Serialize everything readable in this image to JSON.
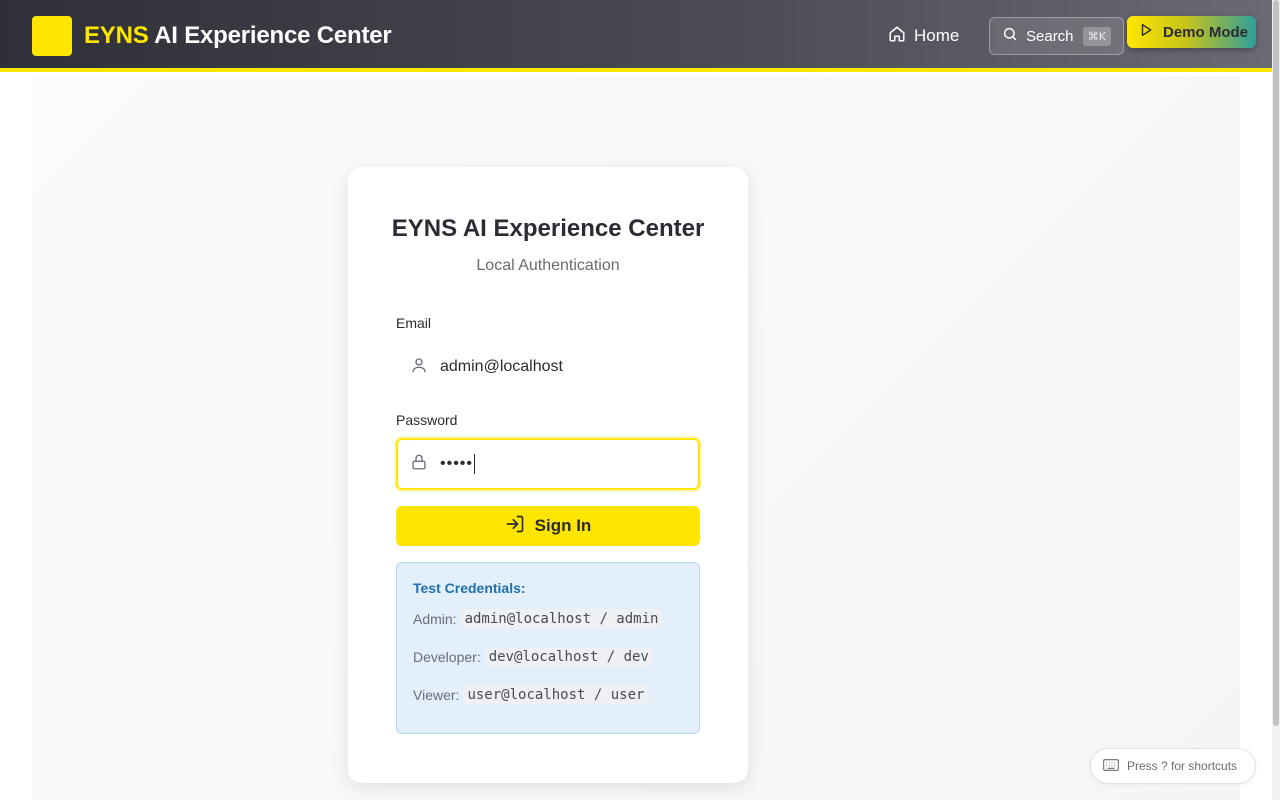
{
  "header": {
    "brand_accent": "EYNS",
    "brand_rest": " AI Experience Center",
    "nav_home": "Home",
    "search_label": "Search",
    "search_shortcut": "⌘K",
    "demo_label": "Demo Mode"
  },
  "card": {
    "title": "EYNS AI Experience Center",
    "subtitle": "Local Authentication",
    "email_label": "Email",
    "email_value": "admin@localhost",
    "password_label": "Password",
    "password_value": "•••••",
    "signin_label": "Sign In"
  },
  "credentials": {
    "title": "Test Credentials:",
    "rows": [
      {
        "role": "Admin:",
        "value": "admin@localhost / admin"
      },
      {
        "role": "Developer:",
        "value": "dev@localhost / dev"
      },
      {
        "role": "Viewer:",
        "value": "user@localhost / user"
      }
    ]
  },
  "footer": {
    "shortcut_hint": "Press ? for shortcuts"
  },
  "colors": {
    "accent": "#ffe600",
    "header_dark": "#2f2f38",
    "info_bg": "#e3f0fc",
    "info_title": "#1f6fb0"
  },
  "icons": [
    "home-icon",
    "search-icon",
    "play-icon",
    "user-icon",
    "lock-icon",
    "sign-in-icon",
    "keyboard-icon"
  ]
}
